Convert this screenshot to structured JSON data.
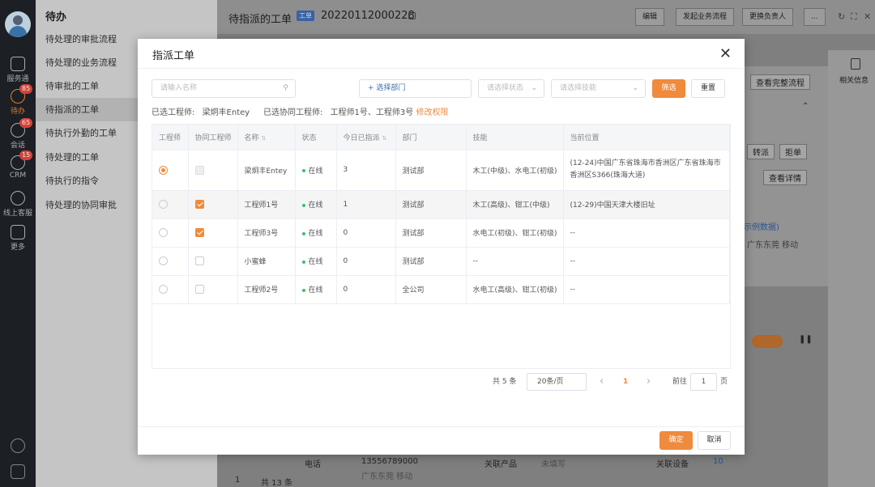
{
  "rail": {
    "items": [
      {
        "label": "服务通",
        "badge": ""
      },
      {
        "label": "待办",
        "badge": "85"
      },
      {
        "label": "会话",
        "badge": "65"
      },
      {
        "label": "CRM",
        "badge": "15"
      },
      {
        "label": "线上客服",
        "badge": ""
      },
      {
        "label": "更多",
        "badge": ""
      }
    ]
  },
  "sidebar": {
    "title": "待办",
    "items": [
      {
        "label": "待处理的审批流程"
      },
      {
        "label": "待处理的业务流程"
      },
      {
        "label": "待审批的工单"
      },
      {
        "label": "待指派的工单"
      },
      {
        "label": "待执行外勤的工单"
      },
      {
        "label": "待处理的工单"
      },
      {
        "label": "待执行的指令"
      },
      {
        "label": "待处理的协同审批"
      }
    ]
  },
  "header": {
    "crumb": "待指派的工单",
    "tag": "工单",
    "order_no": "20220112000228",
    "buttons": {
      "edit": "编辑",
      "start_flow": "发起业务流程",
      "change_owner": "更换负责人",
      "more": "..."
    }
  },
  "background": {
    "view_flow": "查看完整流程",
    "related_info": "相关信息",
    "transfer": "转派",
    "reject": "拒单",
    "view_detail": "查看详情",
    "sample": "示例数据)",
    "region": "广东东莞 移动",
    "phone_label": "电话",
    "phone": "13556789000",
    "phone_region": "广东东莞 移动",
    "related_product": "关联产品",
    "not_filled": "未填写",
    "related_device": "关联设备",
    "device_count": "10",
    "total13": "共 13 条",
    "page1": "1"
  },
  "modal": {
    "title": "指派工单",
    "filters": {
      "name_placeholder": "请输入名称",
      "dept_label": "+ 选择部门",
      "status_placeholder": "请选择状态",
      "skill_placeholder": "请选择技能",
      "filter_btn": "筛选",
      "reset_btn": "重置"
    },
    "selected": {
      "engineer_label": "已选工程师:",
      "engineer": "梁炯丰Entey",
      "co_label": "已选协同工程师:",
      "co": "工程师1号、工程师3号",
      "modify": "修改权限"
    },
    "table": {
      "headers": [
        "工程师",
        "协同工程师",
        "名称",
        "状态",
        "今日已指派",
        "部门",
        "技能",
        "当前位置"
      ],
      "rows": [
        {
          "name": "梁炯丰Entey",
          "status": "在线",
          "assigned": "3",
          "dept": "测试部",
          "skill": "木工(中级)、水电工(初级)",
          "location": "(12-24)中国广东省珠海市香洲区广东省珠海市香洲区S366(珠海大道)",
          "radio": true,
          "co": "disabled"
        },
        {
          "name": "工程师1号",
          "status": "在线",
          "assigned": "1",
          "dept": "测试部",
          "skill": "木工(高级)、钳工(中级)",
          "location": "(12-29)中国天津大楼旧址",
          "radio": false,
          "co": "checked"
        },
        {
          "name": "工程师3号",
          "status": "在线",
          "assigned": "0",
          "dept": "测试部",
          "skill": "水电工(初级)、钳工(初级)",
          "location": "--",
          "radio": false,
          "co": "checked"
        },
        {
          "name": "小蜜蜂",
          "status": "在线",
          "assigned": "0",
          "dept": "测试部",
          "skill": "--",
          "location": "--",
          "radio": false,
          "co": "unchecked"
        },
        {
          "name": "工程师2号",
          "status": "在线",
          "assigned": "0",
          "dept": "全公司",
          "skill": "水电工(高级)、钳工(初级)",
          "location": "--",
          "radio": false,
          "co": "unchecked"
        }
      ]
    },
    "pagination": {
      "total": "共 5 条",
      "page_size": "20条/页",
      "prev": "‹",
      "current": "1",
      "next": "›",
      "goto_label": "前往",
      "goto_value": "1",
      "page_suffix": "页"
    },
    "footer": {
      "confirm": "确定",
      "cancel": "取消"
    }
  },
  "colors": {
    "accent": "#f08a3c",
    "online": "#3bbf6b",
    "tag": "#3d6bb3"
  }
}
